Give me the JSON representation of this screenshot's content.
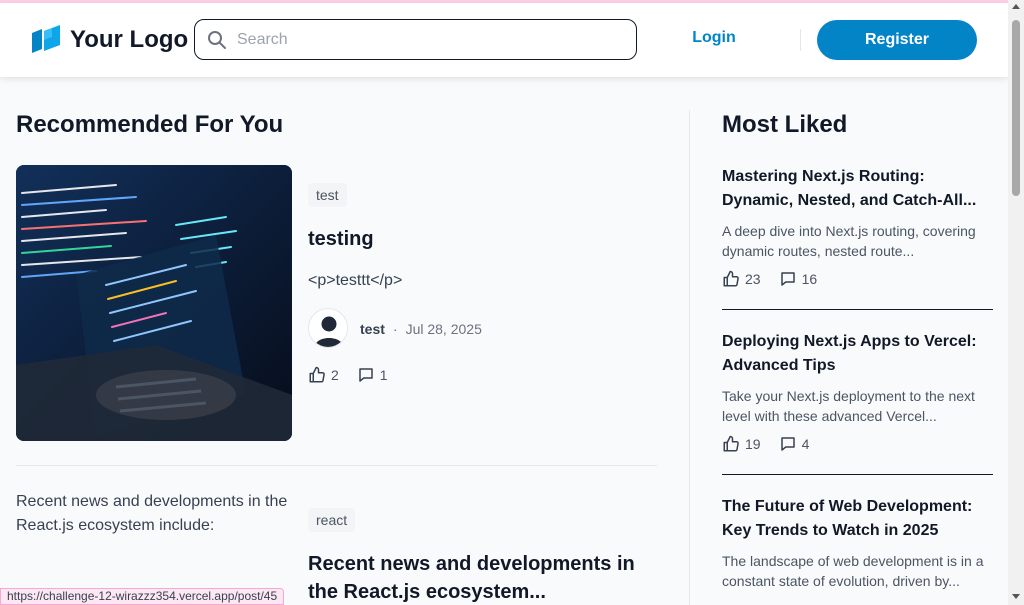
{
  "header": {
    "logo_text": "Your Logo",
    "search_placeholder": "Search",
    "login_label": "Login",
    "register_label": "Register",
    "brand_color": "#0284c7"
  },
  "recommended": {
    "heading": "Recommended For You",
    "posts": [
      {
        "tag": "test",
        "title": "testing",
        "body": "<p>testtt</p>",
        "author": "test",
        "separator": "·",
        "date": "Jul 28, 2025",
        "likes": "2",
        "comments": "1"
      },
      {
        "image_alt": "Recent news and developments in the React.js ecosystem include:",
        "tag": "react",
        "title": "Recent news and developments in the React.js ecosystem..."
      }
    ]
  },
  "most_liked": {
    "heading": "Most Liked",
    "items": [
      {
        "title": "Mastering Next.js Routing: Dynamic, Nested, and Catch-All...",
        "desc": "A deep dive into Next.js routing, covering dynamic routes, nested route...",
        "likes": "23",
        "comments": "16"
      },
      {
        "title": "Deploying Next.js Apps to Vercel: Advanced Tips",
        "desc": "Take your Next.js deployment to the next level with these advanced Vercel...",
        "likes": "19",
        "comments": "4"
      },
      {
        "title": "The Future of Web Development: Key Trends to Watch in 2025",
        "desc": "The landscape of web development is in a constant state of evolution, driven by..."
      }
    ]
  },
  "status_url": "https://challenge-12-wirazzz354.vercel.app/post/45"
}
